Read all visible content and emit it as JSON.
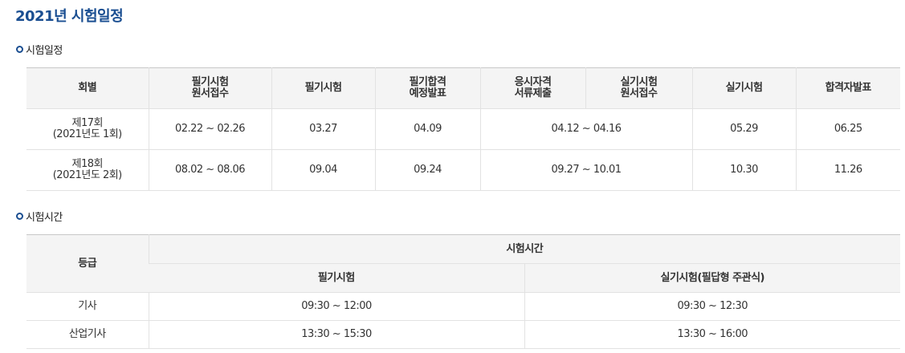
{
  "page_title": "2021년 시험일정",
  "schedule_section": {
    "title": "시험일정",
    "headers": [
      "회별",
      "필기시험 원서접수",
      "필기시험",
      "필기합격 예정발표",
      "응시자격 서류제출",
      "실기시험 원서접수",
      "실기시험",
      "합격자발표"
    ],
    "header_lines": [
      [
        "회별"
      ],
      [
        "필기시험",
        "원서접수"
      ],
      [
        "필기시험"
      ],
      [
        "필기합격",
        "예정발표"
      ],
      [
        "응시자격",
        "서류제출"
      ],
      [
        "실기시험",
        "원서접수"
      ],
      [
        "실기시험"
      ],
      [
        "합격자발표"
      ]
    ],
    "rows": [
      {
        "round": "제17회",
        "year": "(2021년도 1회)",
        "written_application": "02.22 ~ 02.26",
        "written_exam": "03.27",
        "written_result": "04.09",
        "docs_and_practical_application": "04.12 ~ 04.16",
        "practical_exam": "05.29",
        "final_result": "06.25"
      },
      {
        "round": "제18회",
        "year": "(2021년도 2회)",
        "written_application": "08.02 ~ 08.06",
        "written_exam": "09.04",
        "written_result": "09.24",
        "docs_and_practical_application": "09.27 ~ 10.01",
        "practical_exam": "10.30",
        "final_result": "11.26"
      }
    ]
  },
  "time_section": {
    "title": "시험시간",
    "headers": {
      "grade": "등급",
      "exam_time": "시험시간",
      "written": "필기시험",
      "practical": "실기시험(필답형 주관식)"
    },
    "rows": [
      {
        "grade": "기사",
        "written": "09:30 ~ 12:00",
        "practical": "09:30 ~ 12:30"
      },
      {
        "grade": "산업기사",
        "written": "13:30 ~ 15:30",
        "practical": "13:30 ~ 16:00"
      }
    ]
  },
  "colors": {
    "title_blue": "#1a4e91",
    "header_bg": "#f4f4f4",
    "border": "#e2e2e2"
  }
}
